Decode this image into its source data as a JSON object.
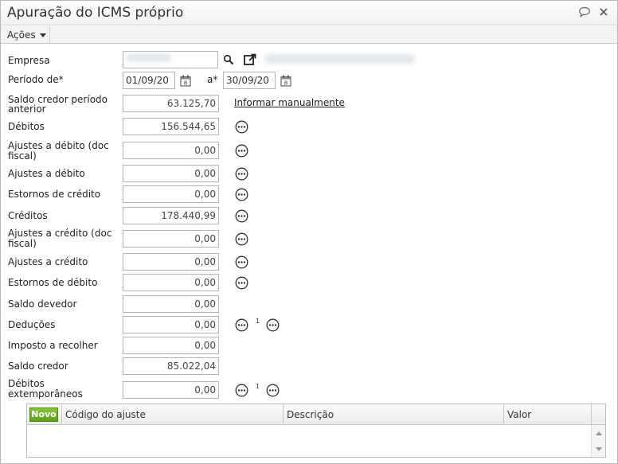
{
  "window": {
    "title": "Apuração do ICMS próprio"
  },
  "toolbar": {
    "actions_label": "Ações"
  },
  "form": {
    "empresa_label": "Empresa",
    "periodo_label": "Período de*",
    "ate_label": "a*",
    "data_inicio": "01/09/20",
    "data_fim": "30/09/20",
    "informar_manualmente": "Informar manualmente",
    "rows": {
      "saldo_credor_anterior": {
        "label1": "Saldo credor período",
        "label2": "anterior",
        "value": "63.125,70"
      },
      "debitos": {
        "label": "Débitos",
        "value": "156.544,65"
      },
      "ajustes_debito_doc": {
        "label1": "Ajustes a débito (doc",
        "label2": "fiscal)",
        "value": "0,00"
      },
      "ajustes_debito": {
        "label": "Ajustes a débito",
        "value": "0,00"
      },
      "estornos_credito": {
        "label": "Estornos de crédito",
        "value": "0,00"
      },
      "creditos": {
        "label": "Créditos",
        "value": "178.440,99"
      },
      "ajustes_credito_doc": {
        "label1": "Ajustes a crédito (doc",
        "label2": "fiscal)",
        "value": "0,00"
      },
      "ajustes_credito": {
        "label": "Ajustes a crédito",
        "value": "0,00"
      },
      "estornos_debito": {
        "label": "Estornos de débito",
        "value": "0,00"
      },
      "saldo_devedor": {
        "label": "Saldo devedor",
        "value": "0,00"
      },
      "deducoes": {
        "label": "Deduções",
        "value": "0,00",
        "marker": "1"
      },
      "imposto_recolher": {
        "label": "Imposto a recolher",
        "value": "0,00"
      },
      "saldo_credor": {
        "label": "Saldo credor",
        "value": "85.022,04"
      },
      "debitos_extemporaneos": {
        "label1": "Débitos",
        "label2": "extemporâneos",
        "value": "0,00",
        "marker": "1"
      }
    }
  },
  "grid": {
    "new_button": "Novo",
    "columns": [
      "Código do ajuste",
      "Descrição",
      "Valor"
    ]
  }
}
